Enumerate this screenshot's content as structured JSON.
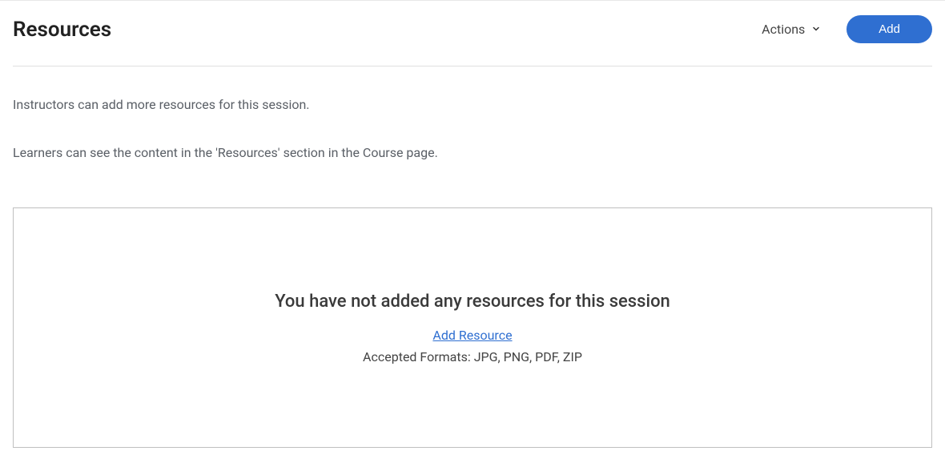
{
  "header": {
    "title": "Resources",
    "actions_label": "Actions",
    "add_label": "Add"
  },
  "description": {
    "line1": "Instructors can add more resources for this session.",
    "line2": "Learners can see the content in the 'Resources' section in the Course page."
  },
  "empty_state": {
    "message": "You have not added any resources for this session",
    "add_link": "Add Resource",
    "formats": "Accepted Formats: JPG, PNG, PDF, ZIP"
  }
}
